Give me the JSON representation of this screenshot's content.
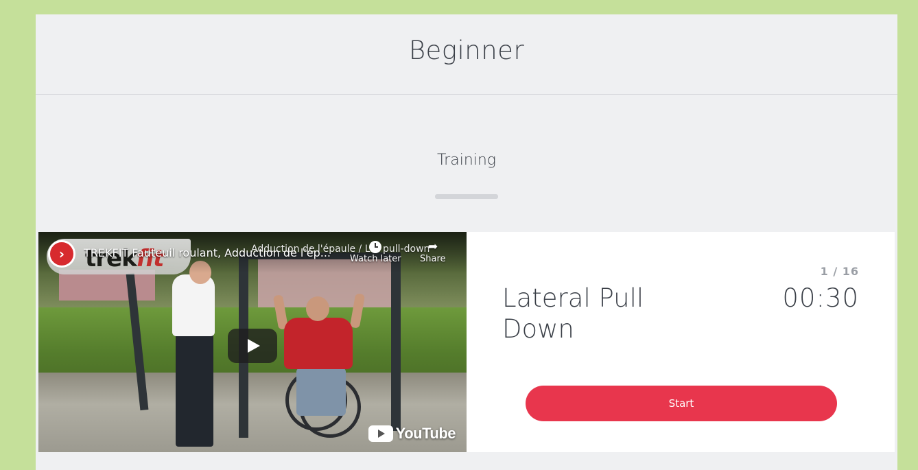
{
  "page": {
    "title": "Beginner",
    "section_title": "Training"
  },
  "video": {
    "channel_brand_prefix": "trek",
    "channel_brand_suffix": "fit",
    "title": "TREKFIT Fauteuil roulant, Adduction de l'ép...",
    "subtitle": "Adduction de l'épaule / Lat pull-down",
    "watch_later_label": "Watch later",
    "share_label": "Share",
    "youtube_label": "YouTube",
    "play_icon": "play-icon",
    "watch_later_icon": "clock-icon",
    "share_icon": "share-arrow-icon"
  },
  "exercise": {
    "counter": "1 / 16",
    "name": "Lateral Pull Down",
    "timer": "00:30",
    "start_label": "Start"
  },
  "colors": {
    "background": "#c5e09a",
    "panel": "#eff0f2",
    "accent": "#e8364d",
    "text": "#3a3f47",
    "muted": "#9a9ea5"
  }
}
